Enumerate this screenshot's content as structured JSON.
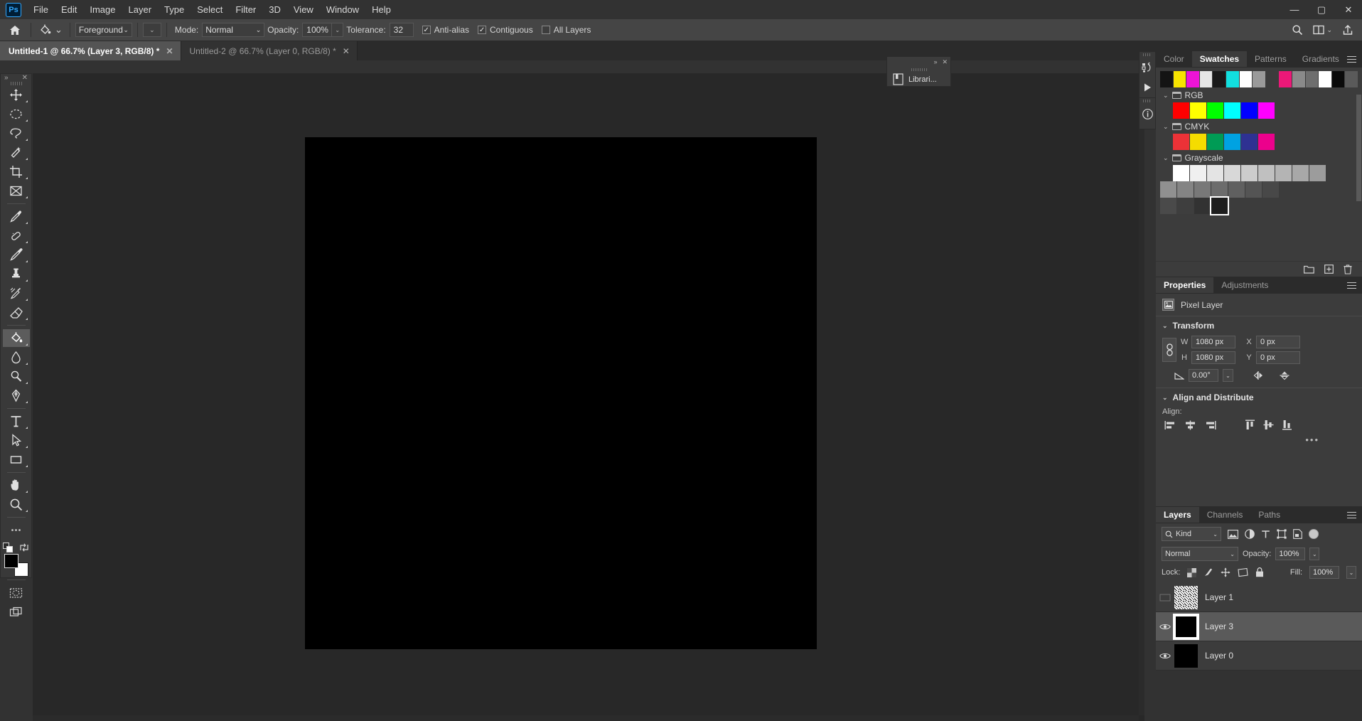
{
  "app": {
    "name": "Adobe Photoshop",
    "logo_text": "Ps"
  },
  "menubar": {
    "items": [
      "File",
      "Edit",
      "Image",
      "Layer",
      "Type",
      "Select",
      "Filter",
      "3D",
      "View",
      "Window",
      "Help"
    ],
    "window_controls": {
      "minimize": "—",
      "maximize": "▢",
      "close": "✕"
    }
  },
  "optionsbar": {
    "home_icon": "home-icon",
    "tool_icon": "paint-bucket-icon",
    "fill_source": "Foreground",
    "mode_label": "Mode:",
    "mode_value": "Normal",
    "opacity_label": "Opacity:",
    "opacity_value": "100%",
    "tolerance_label": "Tolerance:",
    "tolerance_value": "32",
    "checkboxes": [
      {
        "label": "Anti-alias",
        "checked": true
      },
      {
        "label": "Contiguous",
        "checked": true
      },
      {
        "label": "All Layers",
        "checked": false
      }
    ],
    "search_icon": "search-icon",
    "arrange_icon": "arrange-documents-icon",
    "share_icon": "share-icon"
  },
  "tabs": [
    {
      "label": "Untitled-1 @ 66.7% (Layer 3, RGB/8) *",
      "active": true,
      "close": "✕"
    },
    {
      "label": "Untitled-2 @ 66.7% (Layer 0, RGB/8) *",
      "active": false,
      "close": "✕"
    }
  ],
  "tab_right": {
    "collapse": "»"
  },
  "toolbar": {
    "collapse": "»",
    "close": "✕",
    "tools": [
      {
        "name": "move-tool",
        "label": "Move Tool",
        "active": false
      },
      {
        "name": "marquee-tool",
        "label": "Elliptical Marquee Tool",
        "active": false
      },
      {
        "name": "lasso-tool",
        "label": "Lasso Tool",
        "active": false
      },
      {
        "name": "magic-wand-tool",
        "label": "Object Selection Tool",
        "active": false
      },
      {
        "name": "crop-tool",
        "label": "Crop Tool",
        "active": false
      },
      {
        "name": "frame-tool",
        "label": "Frame Tool",
        "active": false
      },
      {
        "name": "eyedropper-tool",
        "label": "Eyedropper Tool",
        "active": false
      },
      {
        "name": "healing-brush-tool",
        "label": "Spot Healing Brush Tool",
        "active": false
      },
      {
        "name": "brush-tool",
        "label": "Brush Tool",
        "active": false
      },
      {
        "name": "clone-stamp-tool",
        "label": "Clone Stamp Tool",
        "active": false
      },
      {
        "name": "history-brush-tool",
        "label": "History Brush Tool",
        "active": false
      },
      {
        "name": "eraser-tool",
        "label": "Eraser Tool",
        "active": false
      },
      {
        "name": "paint-bucket-tool",
        "label": "Paint Bucket Tool",
        "active": true
      },
      {
        "name": "blur-tool",
        "label": "Blur Tool",
        "active": false
      },
      {
        "name": "dodge-tool",
        "label": "Dodge Tool",
        "active": false
      },
      {
        "name": "pen-tool",
        "label": "Pen Tool",
        "active": false
      },
      {
        "name": "type-tool",
        "label": "Horizontal Type Tool",
        "active": false
      },
      {
        "name": "path-selection-tool",
        "label": "Path Selection Tool",
        "active": false
      },
      {
        "name": "rectangle-tool",
        "label": "Rectangle Tool",
        "active": false
      },
      {
        "name": "hand-tool",
        "label": "Hand Tool",
        "active": false
      },
      {
        "name": "zoom-tool",
        "label": "Zoom Tool",
        "active": false
      },
      {
        "name": "edit-toolbar",
        "label": "Edit Toolbar",
        "active": false
      }
    ],
    "colors": {
      "foreground": "#000000",
      "background": "#ffffff"
    },
    "quickmask_label": "Edit in Quick Mask Mode",
    "screenmode_label": "Change Screen Mode"
  },
  "libraries_panel": {
    "title": "Librari...",
    "collapse": "»",
    "close": "✕",
    "icon": "libraries-icon"
  },
  "rail": {
    "buttons": [
      {
        "name": "history-icon",
        "label": "History"
      },
      {
        "name": "play-icon",
        "label": "Actions"
      },
      {
        "name": "info-icon",
        "label": "Info"
      }
    ]
  },
  "swatches_panel": {
    "tabs": [
      "Color",
      "Swatches",
      "Patterns",
      "Gradients"
    ],
    "active_tab": "Swatches",
    "recent": [
      "#141414",
      "#f7e400",
      "#ec14d6",
      "#e6e6e6",
      "#1a1a1a",
      "#12e0e0",
      "#fefefe",
      "#9a9a9a",
      "#3c3c3c",
      "#ec1878",
      "#8a8a8a",
      "#6e6e6e",
      "#ffffff",
      "#0a0a0a",
      "#5a5a5a"
    ],
    "groups": [
      {
        "name": "RGB",
        "colors": [
          "#ff0000",
          "#ffff00",
          "#00ff00",
          "#00ffff",
          "#0000ff",
          "#ff00ff"
        ]
      },
      {
        "name": "CMYK",
        "colors": [
          "#ec3237",
          "#f5dc00",
          "#009b55",
          "#00a2e2",
          "#2e3192",
          "#ec018c"
        ]
      },
      {
        "name": "Grayscale",
        "rows": [
          [
            "#ffffff",
            "#f0f0f0",
            "#e4e4e4",
            "#d8d8d8",
            "#cccccc",
            "#c0c0c0",
            "#b4b4b4",
            "#a8a8a8",
            "#9c9c9c"
          ],
          [
            "#909090",
            "#848484",
            "#787878",
            "#6c6c6c",
            "#606060",
            "#545454",
            "#484848",
            "#3c3c3c"
          ],
          [
            "#4a4a4a",
            "#3e3e3e",
            "#323232",
            "#1e1e1e"
          ]
        ]
      }
    ],
    "selected_swatch_index": 3,
    "footer_icons": [
      "new-group-icon",
      "new-swatch-icon",
      "delete-swatch-icon"
    ]
  },
  "properties_panel": {
    "tabs": [
      "Properties",
      "Adjustments"
    ],
    "active_tab": "Properties",
    "layer_type": "Pixel Layer",
    "layer_type_icon": "pixel-layer-icon",
    "transform": {
      "title": "Transform",
      "link_icon": "link-icon",
      "w_label": "W",
      "w_value": "1080 px",
      "h_label": "H",
      "h_value": "1080 px",
      "x_label": "X",
      "x_value": "0 px",
      "y_label": "Y",
      "y_value": "0 px",
      "angle_icon": "angle-icon",
      "angle_value": "0.00°",
      "flip_h_icon": "flip-horizontal-icon",
      "flip_v_icon": "flip-vertical-icon"
    },
    "align": {
      "title": "Align and Distribute",
      "label": "Align:",
      "buttons": [
        "align-left-icon",
        "align-center-horizontal-icon",
        "align-right-icon",
        "align-top-icon",
        "align-center-vertical-icon",
        "align-bottom-icon"
      ],
      "more": "•••"
    }
  },
  "layers_panel": {
    "tabs": [
      "Layers",
      "Channels",
      "Paths"
    ],
    "active_tab": "Layers",
    "filter": {
      "search_icon": "search-icon",
      "kind_label": "Kind",
      "type_icons": [
        "pixel-filter-icon",
        "adjustment-filter-icon",
        "type-filter-icon",
        "shape-filter-icon",
        "smart-object-filter-icon"
      ],
      "toggle": "filter-toggle"
    },
    "blend_mode": "Normal",
    "opacity_label": "Opacity:",
    "opacity_value": "100%",
    "lock_label": "Lock:",
    "lock_icons": [
      "lock-transparent-icon",
      "lock-image-icon",
      "lock-position-icon",
      "lock-artboard-icon",
      "lock-all-icon"
    ],
    "fill_label": "Fill:",
    "fill_value": "100%",
    "layers": [
      {
        "name": "Layer 1",
        "visible": false,
        "selected": false,
        "thumb": "noise"
      },
      {
        "name": "Layer 3",
        "visible": true,
        "selected": true,
        "thumb": "black"
      },
      {
        "name": "Layer 0",
        "visible": true,
        "selected": false,
        "thumb": "black"
      }
    ]
  },
  "canvas": {
    "document_color": "#000000",
    "zoom": "66.7%"
  }
}
